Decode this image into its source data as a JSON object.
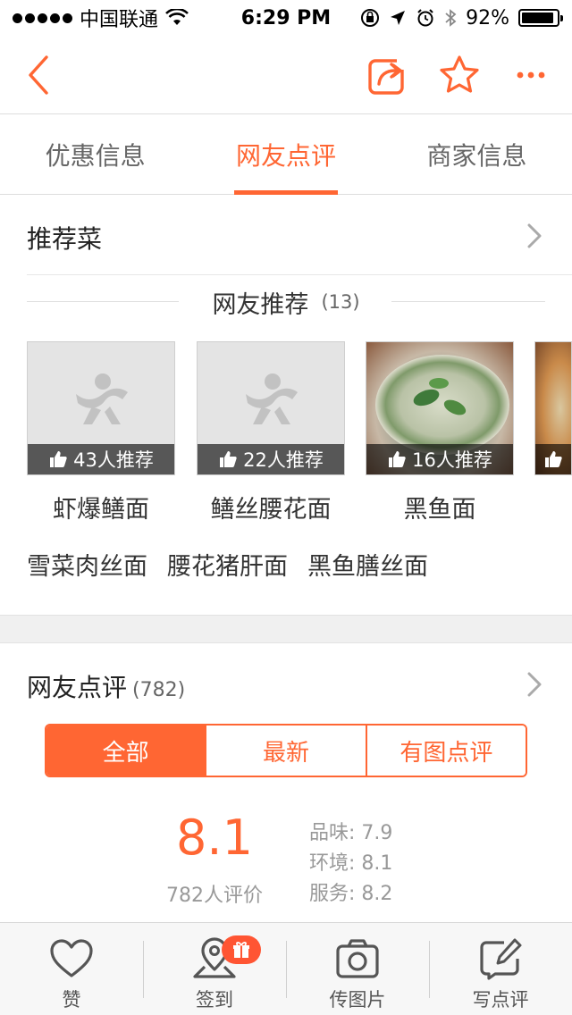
{
  "status_bar": {
    "carrier": "中国联通",
    "time": "6:29 PM",
    "battery": "92%",
    "battery_level": 0.92
  },
  "nav": {
    "back_icon": "chevron-left-icon",
    "share_icon": "share-icon",
    "favorite_icon": "star-icon",
    "more_icon": "more-dots-icon",
    "accent_color": "#ff6633"
  },
  "tabs": [
    {
      "label": "优惠信息",
      "active": false
    },
    {
      "label": "网友点评",
      "active": true
    },
    {
      "label": "商家信息",
      "active": false
    }
  ],
  "recommended": {
    "title": "推荐菜",
    "subtitle": "网友推荐",
    "subtitle_count": "(13)",
    "dishes": [
      {
        "name": "虾爆鳝面",
        "badge": "43人推荐",
        "image": "placeholder"
      },
      {
        "name": "鳝丝腰花面",
        "badge": "22人推荐",
        "image": "placeholder"
      },
      {
        "name": "黑鱼面",
        "badge": "16人推荐",
        "image": "photo"
      }
    ],
    "more_dishes": [
      "雪菜肉丝面",
      "腰花猪肝面",
      "黑鱼膳丝面"
    ]
  },
  "reviews": {
    "title": "网友点评",
    "count": "(782)",
    "filters": [
      {
        "label": "全部",
        "active": true
      },
      {
        "label": "最新",
        "active": false
      },
      {
        "label": "有图点评",
        "active": false
      }
    ],
    "score": "8.1",
    "score_count": "782人评价",
    "sub_scores": [
      "品味: 7.9",
      "环境: 8.1",
      "服务: 8.2"
    ]
  },
  "toolbar": {
    "items": [
      {
        "label": "赞",
        "icon": "heart-icon"
      },
      {
        "label": "签到",
        "icon": "location-pin-icon",
        "badge_icon": "gift-icon"
      },
      {
        "label": "传图片",
        "icon": "camera-icon"
      },
      {
        "label": "写点评",
        "icon": "edit-icon"
      }
    ]
  }
}
